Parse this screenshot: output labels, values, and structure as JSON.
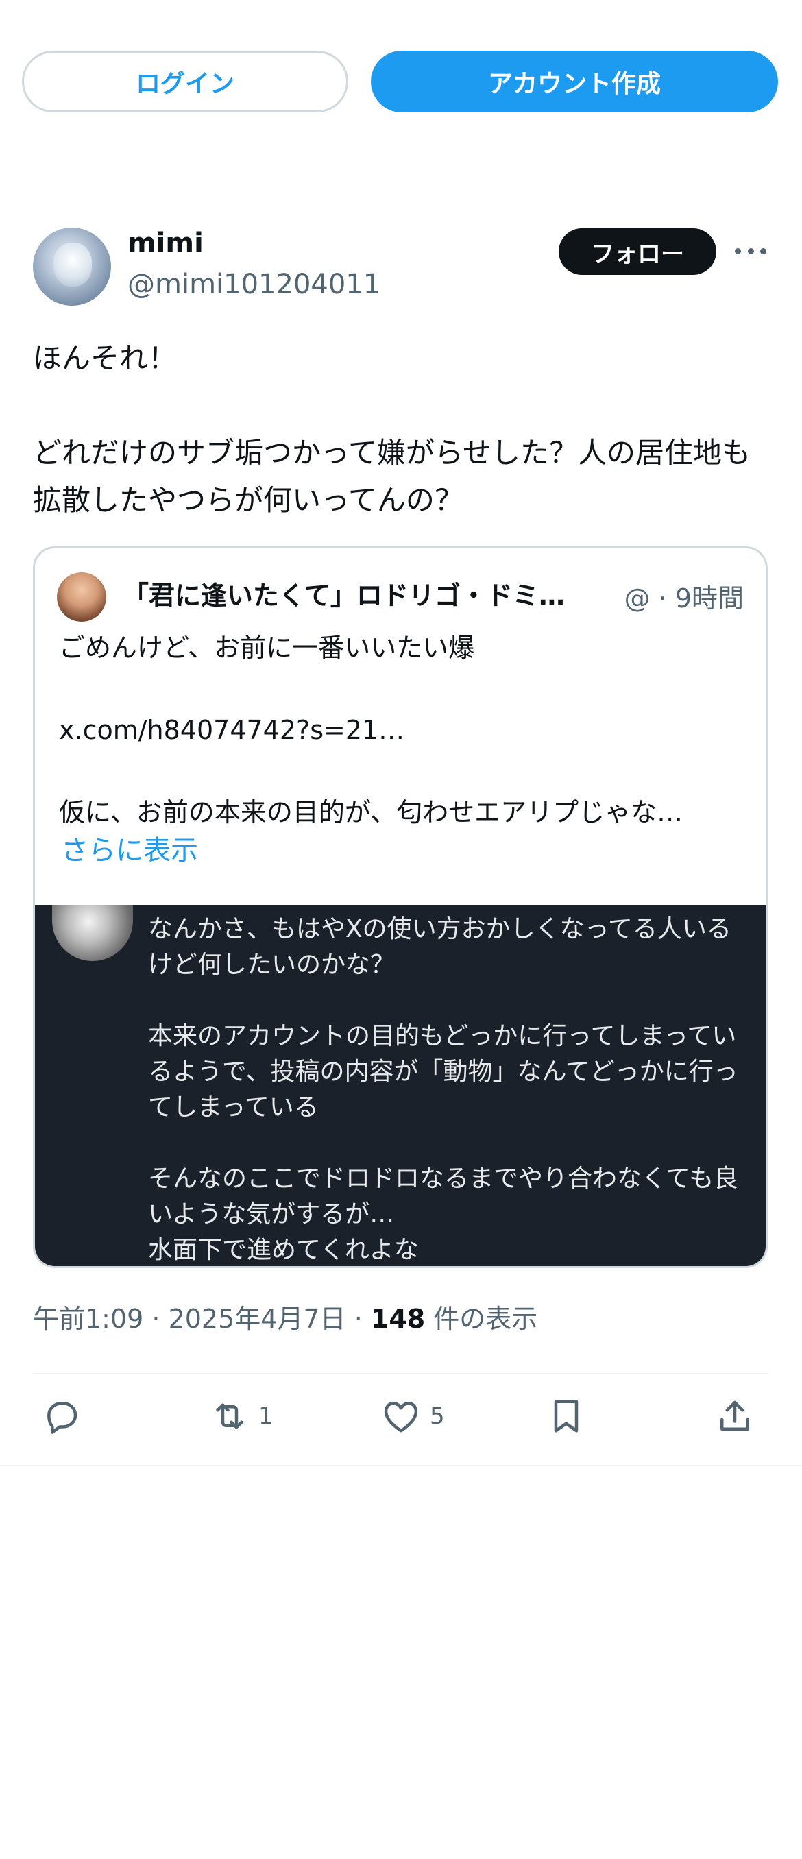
{
  "auth": {
    "login_label": "ログイン",
    "signup_label": "アカウント作成"
  },
  "post": {
    "display_name": "mimi",
    "handle": "@mimi101204011",
    "follow_label": "フォロー",
    "text": "ほんそれ！\n\nどれだけのサブ垢つかって嫌がらせした？人の居住地も拡散したやつらが何いってんの？",
    "quote": {
      "name": "「君に逢いたくて」ロドリゴ・ドミ…",
      "meta": "@ · 9時間",
      "text": "ごめんけど、お前に一番いいたい爆\n\nx.com/h84074742?s=21…\n\n仮に、お前の本来の目的が、匂わせエアリプじゃな…",
      "show_more": "さらに表示",
      "media_text": "なんかさ、もはやXの使い方おかしくなってる人いるけど何したいのかな？\n\n本来のアカウントの目的もどっかに行ってしまっているようで、投稿の内容が「動物」なんてどっかに行ってしまっている\n\nそんなのここでドロドロなるまでやり合わなくても良いような気がするが…\n水面下で進めてくれよな"
    },
    "timestamp": "午前1:09 · 2025年4月7日 · ",
    "views_count": "148",
    "views_label": " 件の表示",
    "actions": {
      "reply_icon": "reply-icon",
      "repost_icon": "repost-icon",
      "repost_count": "1",
      "like_icon": "heart-icon",
      "like_count": "5",
      "bookmark_icon": "bookmark-icon",
      "share_icon": "share-icon"
    }
  },
  "colors": {
    "accent": "#1d9bf0",
    "text": "#0f1419",
    "secondary": "#536471",
    "border": "#cfd9de",
    "media_bg": "#1a212b"
  }
}
